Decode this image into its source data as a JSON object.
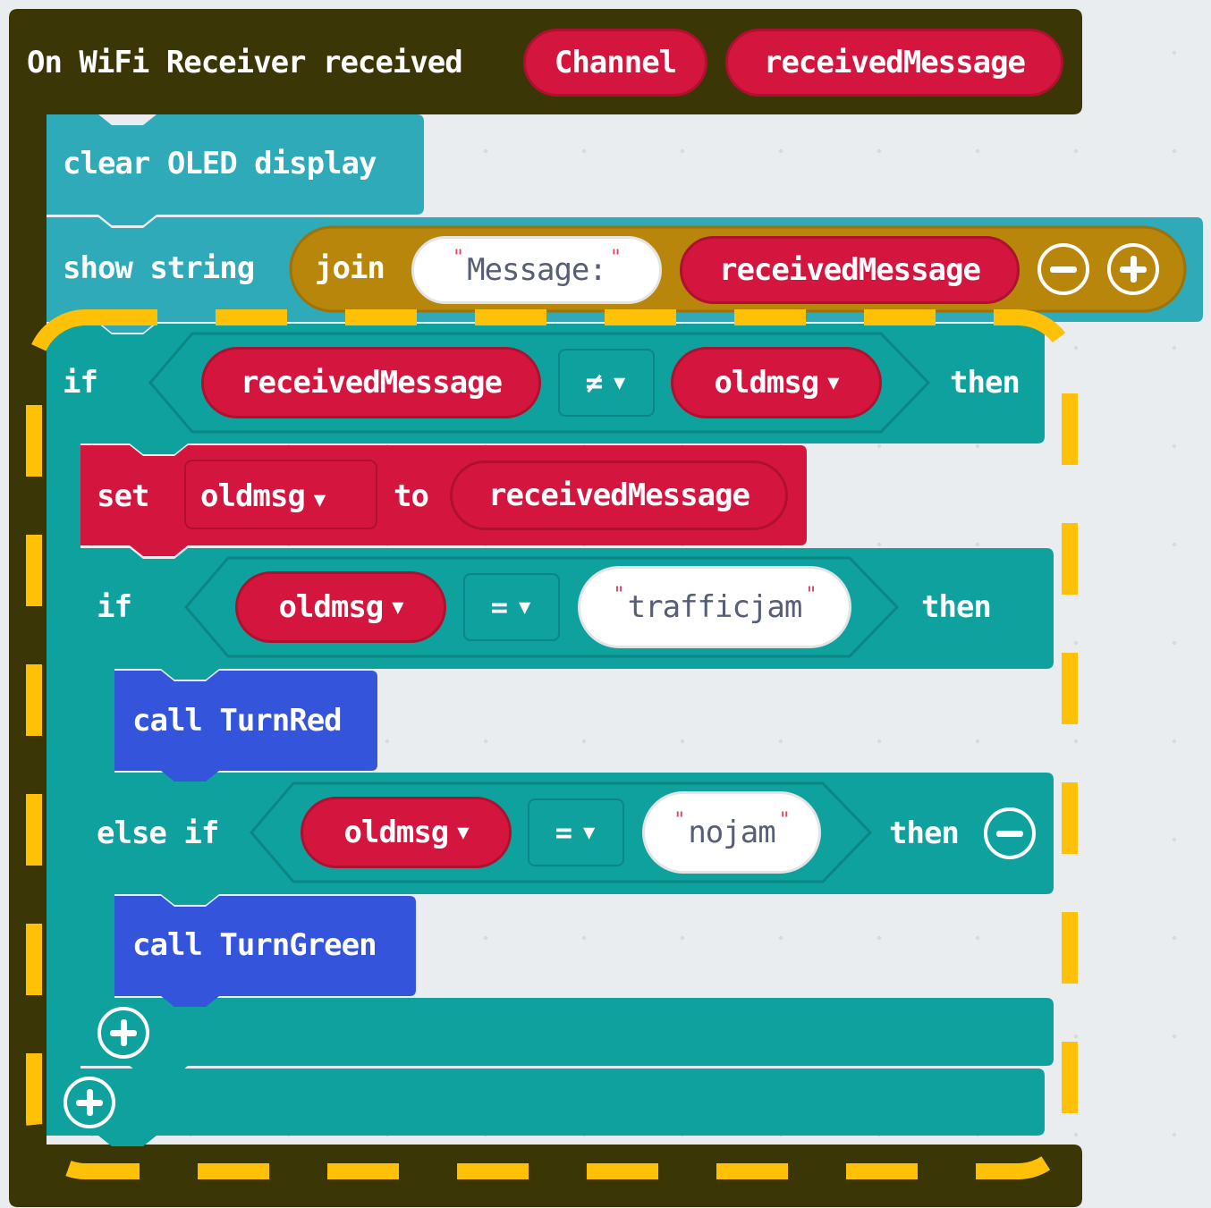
{
  "event_block": {
    "label": "On WiFi Receiver received",
    "param_channel": "Channel",
    "param_message": "receivedMessage"
  },
  "clear_block": {
    "label": "clear OLED display"
  },
  "show_block": {
    "label": "show string",
    "join_label": "join",
    "text_value": "Message: ",
    "var_value": "receivedMessage"
  },
  "if_block": {
    "if_label": "if",
    "left": "receivedMessage",
    "operator": "≠",
    "right": "oldmsg",
    "then_label": "then"
  },
  "set_block": {
    "set_label": "set",
    "var": "oldmsg",
    "to_label": "to",
    "value": "receivedMessage"
  },
  "inner_if": {
    "if_label": "if",
    "left": "oldmsg",
    "operator": "=",
    "right_text": "trafficjam",
    "then_label": "then"
  },
  "call_red": {
    "label": "call TurnRed"
  },
  "else_if": {
    "label": "else if",
    "left": "oldmsg",
    "operator": "=",
    "right_text": "nojam",
    "then_label": "then"
  },
  "call_green": {
    "label": "call TurnGreen"
  },
  "colors": {
    "event": "#3a3606",
    "display": "#2eaab8",
    "join": "#b8860b",
    "logic": "#0fa19e",
    "variable": "#d4163f",
    "function": "#3455db",
    "highlight": "#ffc107"
  }
}
